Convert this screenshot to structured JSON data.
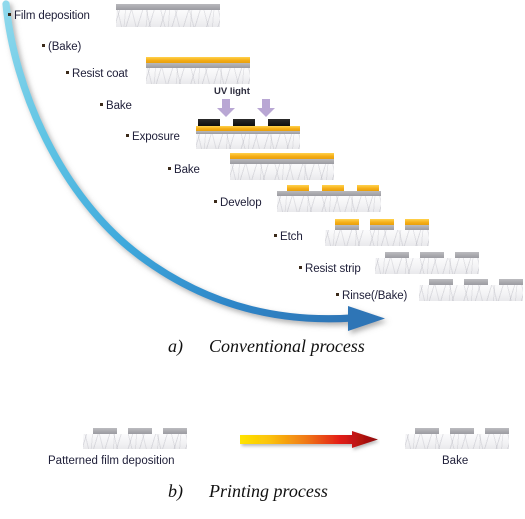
{
  "figure": {
    "panel_a": {
      "caption_letter": "a)",
      "caption_text": "Conventional process",
      "flow_arrow": {
        "name": "blue-curved-arrow",
        "color": "#2E75B6",
        "start_color": "#7FD3E8"
      },
      "steps": [
        {
          "label": "Film deposition"
        },
        {
          "label": "(Bake)"
        },
        {
          "label": "Resist coat"
        },
        {
          "label": "Bake"
        },
        {
          "label": "Exposure"
        },
        {
          "label": "Bake"
        },
        {
          "label": "Develop"
        },
        {
          "label": "Etch"
        },
        {
          "label": "Resist strip"
        },
        {
          "label": "Rinse(/Bake)"
        }
      ],
      "exposure_annotation": {
        "label": "UV light",
        "arrow_color": "#B9A7D4",
        "arrow_count": 2
      },
      "layer_colors": {
        "substrate": "#f2f2f4",
        "film": "#a8a8ad",
        "resist": "#f5ad15",
        "mask": "#111111"
      }
    },
    "panel_b": {
      "caption_letter": "b)",
      "caption_text": "Printing process",
      "left_label": "Patterned film deposition",
      "right_label": "Bake",
      "arrow": {
        "name": "heat-gradient-arrow",
        "from": "#FFE400",
        "mid": "#F07818",
        "to": "#8F0A0A"
      }
    }
  }
}
